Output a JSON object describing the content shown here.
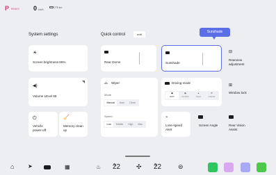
{
  "status": {
    "gear": "P",
    "gear_sub": "READY",
    "speed": "0",
    "speed_unit": "km/h",
    "range": "276 km"
  },
  "sections": {
    "system_settings": "System settings",
    "quick_control": "Quick control",
    "edit": "edit"
  },
  "tooltip": "Sunshade",
  "cards": {
    "brightness": "Screen brightness  85%",
    "volume": "Volume LEvel  68",
    "power_off": "Vehicle power-off",
    "memory": "Memory clean up",
    "rear_dome": "Rear Dome",
    "sunshade": "Sunshade",
    "rearview": "Rearview adjustment",
    "window_lock": "Window lock",
    "lose_speed": "Lose-speed Alert",
    "screen_angle": "Screen Angle",
    "rear_vision": "Rear Vision Assist"
  },
  "wiper": {
    "title": "Wiper",
    "mode_label": "Mode",
    "modes": [
      "Manual",
      "Auto",
      "Close"
    ],
    "speed_label": "Speed",
    "speeds": [
      "Low",
      "Middle",
      "High",
      "Max"
    ]
  },
  "driving": {
    "title": "Driving mode",
    "modes": [
      "ECO",
      "Comfort",
      "Sport",
      "Outside"
    ]
  },
  "dock": {
    "temp_left": "22",
    "temp_left_dec": ".5",
    "temp_right": "22",
    "temp_right_dec": ".5"
  },
  "colors": {
    "accent": "#5b6ee8",
    "gear_p": "#d93a7a",
    "phone": "#2fc55f",
    "messages": "#d9a8f0",
    "media": "#a8a8f5",
    "store": "#4cc94a"
  }
}
